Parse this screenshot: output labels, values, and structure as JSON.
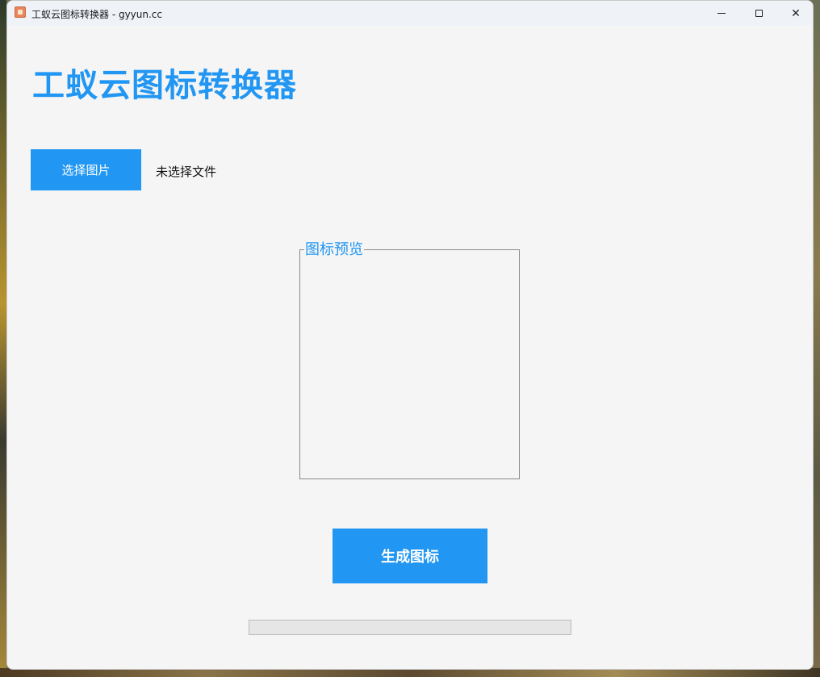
{
  "window": {
    "title": "工蚁云图标转换器 - gyyun.cc",
    "controls": {
      "minimize": "minimize",
      "maximize": "maximize",
      "close": "✕"
    }
  },
  "main": {
    "heading": "工蚁云图标转换器",
    "select_button_label": "选择图片",
    "file_status": "未选择文件",
    "preview_label": "图标预览",
    "generate_button_label": "生成图标",
    "progress": 0
  },
  "colors": {
    "accent": "#2196f3",
    "background": "#f5f5f5",
    "titlebar": "#eff3f8"
  }
}
